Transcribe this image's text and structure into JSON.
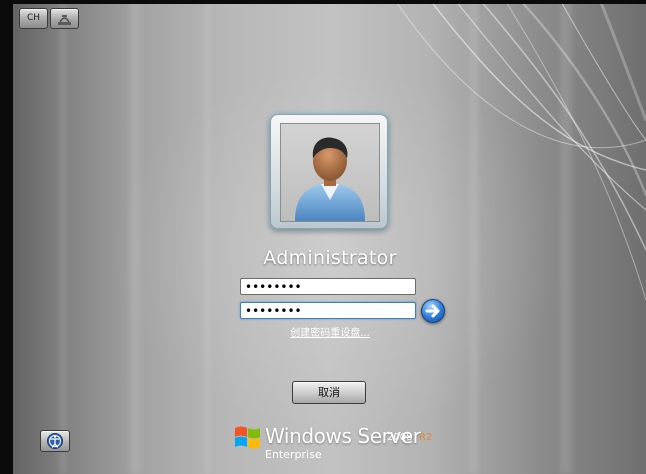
{
  "top_bar": {
    "language_label": "CH",
    "ease_of_access_icon": "ease-of-access-icon"
  },
  "user_tile": {
    "icon": "user-avatar-icon",
    "username": "Administrator"
  },
  "password_field": {
    "value": "••••••••",
    "placeholder": ""
  },
  "confirm_password_field": {
    "value": "••••••••",
    "placeholder": ""
  },
  "submit_icon": "arrow-right-icon",
  "reset_disk_link": "创建密码重设盘...",
  "cancel_button": "取消",
  "bottom_bar": {
    "ease_of_access_icon": "ease-of-access-icon"
  },
  "branding": {
    "logo_icon": "windows-flag-icon",
    "product": "Windows Server",
    "version": "2008",
    "release": "R2",
    "edition": "Enterprise"
  },
  "colors": {
    "background_gray": "#a8a8a8",
    "submit_blue": "#2a7ad9",
    "r2_orange": "#e4893a",
    "field_focus": "#3a7ec4"
  }
}
